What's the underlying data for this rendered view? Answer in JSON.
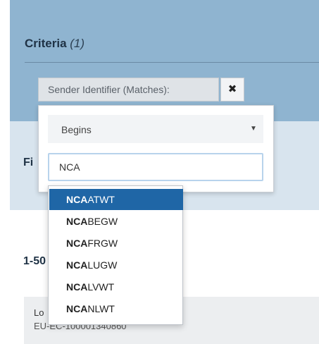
{
  "criteria": {
    "title": "Criteria",
    "count": "(1)"
  },
  "criterion_chip": {
    "label": "Sender Identifier (Matches):",
    "remove_icon": "close-icon",
    "remove_glyph": "✖"
  },
  "popover": {
    "match_mode": {
      "selected": "Begins",
      "arrow_icon": "caret-down-icon",
      "arrow_glyph": "▼"
    },
    "input_value": "NCA"
  },
  "suggestions": [
    {
      "prefix": "NCA",
      "rest": "ATWT",
      "active": true
    },
    {
      "prefix": "NCA",
      "rest": "BEGW",
      "active": false
    },
    {
      "prefix": "NCA",
      "rest": "FRGW",
      "active": false
    },
    {
      "prefix": "NCA",
      "rest": "LUGW",
      "active": false
    },
    {
      "prefix": "NCA",
      "rest": "LVWT",
      "active": false
    },
    {
      "prefix": "NCA",
      "rest": "NLWT",
      "active": false
    }
  ],
  "filter_heading_partial": "Fi",
  "results": {
    "heading_partial": "1-50",
    "card_label_partial": "Lo",
    "card_value": "EU-EC-100001340860"
  },
  "colors": {
    "criteria_panel": "#8fb4d0",
    "active_suggestion": "#1f66a6"
  }
}
